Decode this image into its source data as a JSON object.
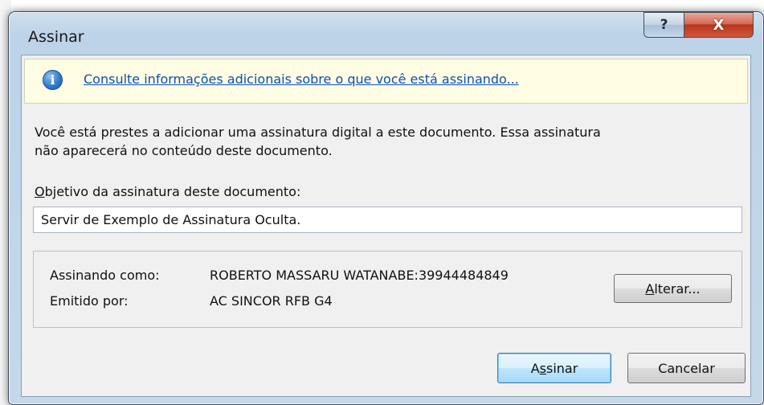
{
  "window": {
    "title": "Assinar",
    "help_glyph": "?",
    "close_glyph": "X"
  },
  "infobar": {
    "icon": "info-icon",
    "link_text": "Consulte informações adicionais sobre o que você está assinando..."
  },
  "description": {
    "line1": "Você está prestes a adicionar uma assinatura digital a este documento. Essa assinatura",
    "line2": "não aparecerá no conteúdo deste documento."
  },
  "purpose": {
    "label_mnemonic": "O",
    "label_rest": "bjetivo da assinatura deste documento:",
    "value": "Servir de Exemplo de Assinatura Oculta."
  },
  "certificate": {
    "signing_as_label": "Assinando como:",
    "signing_as_value": "ROBERTO MASSARU WATANABE:39944484849",
    "issued_by_label": "Emitido por:",
    "issued_by_value": "AC SINCOR RFB G4",
    "change_mnemonic": "A",
    "change_rest": "lterar..."
  },
  "buttons": {
    "sign_pre": "A",
    "sign_mnemonic": "s",
    "sign_rest": "sinar",
    "cancel": "Cancelar"
  },
  "colors": {
    "link": "#0b4fb5",
    "infobar_bg": "#fffde3",
    "close_red": "#c4452a"
  }
}
